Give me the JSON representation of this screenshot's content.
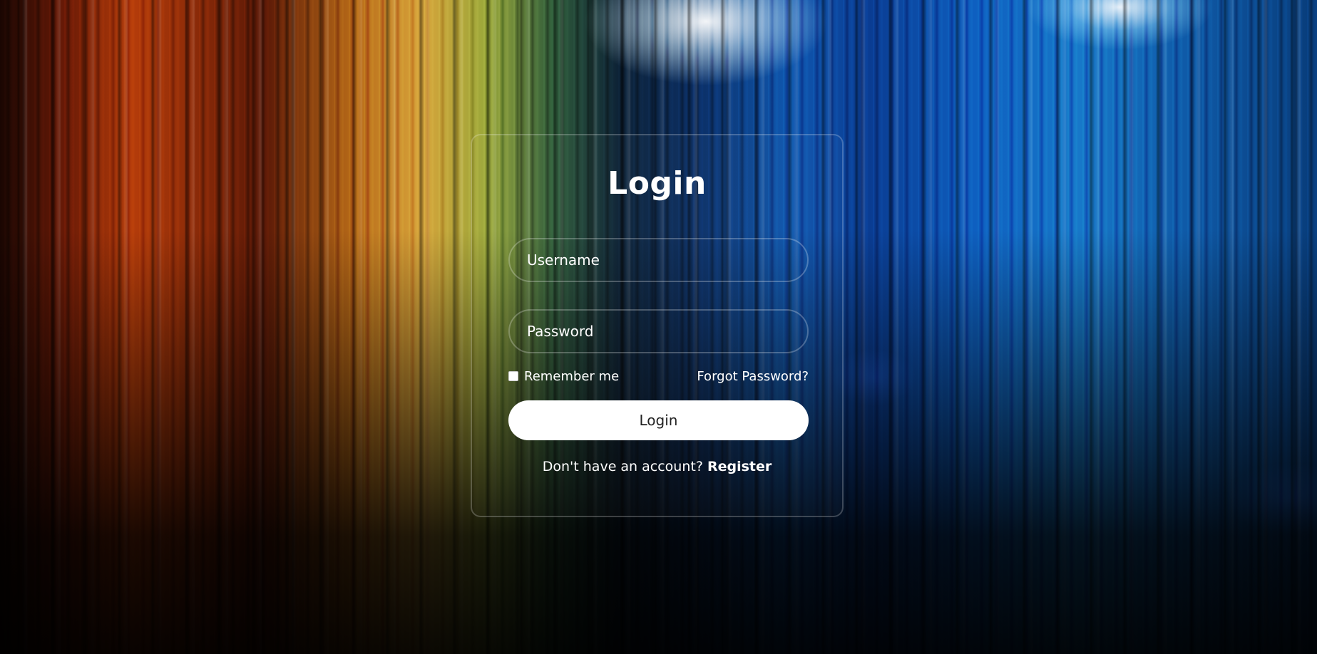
{
  "form": {
    "title": "Login",
    "username_placeholder": "Username",
    "password_placeholder": "Password",
    "remember_label": "Remember me",
    "remember_checked": false,
    "forgot_label": "Forgot Password?",
    "submit_label": "Login",
    "register_prompt": "Don't have an account? ",
    "register_link": "Register"
  }
}
